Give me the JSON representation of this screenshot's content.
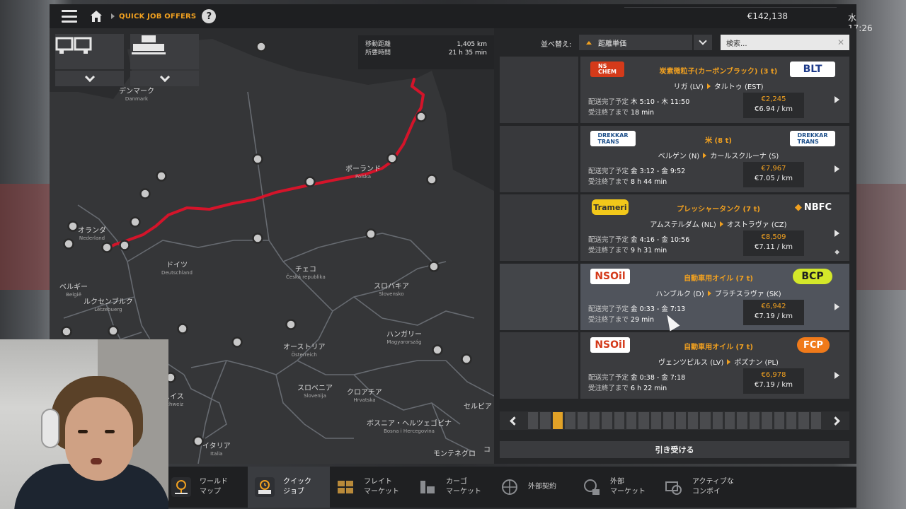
{
  "topbar": {
    "breadcrumb": "QUICK JOB OFFERS",
    "money": "€142,138",
    "clock": "水 17:26"
  },
  "route_info": {
    "distance_label": "移動距離",
    "distance": "1,405 km",
    "time_label": "所要時間",
    "time": "21 h 35 min"
  },
  "map": {
    "labels": [
      {
        "id": "denmark",
        "name": "デンマーク",
        "sub": "Danmark"
      },
      {
        "id": "poland",
        "name": "ポーランド",
        "sub": "Polska"
      },
      {
        "id": "netherlands",
        "name": "オランダ",
        "sub": "Nederland"
      },
      {
        "id": "germany",
        "name": "ドイツ",
        "sub": "Deutschland"
      },
      {
        "id": "czech",
        "name": "チェコ",
        "sub": "Česká republika"
      },
      {
        "id": "belgium",
        "name": "ベルギー",
        "sub": "België"
      },
      {
        "id": "luxembourg",
        "name": "ルクセンブルク",
        "sub": "Lëtzebuerg"
      },
      {
        "id": "slovakia",
        "name": "スロバキア",
        "sub": "Slovensko"
      },
      {
        "id": "hungary",
        "name": "ハンガリー",
        "sub": "Magyarország"
      },
      {
        "id": "austria",
        "name": "オーストリア",
        "sub": "Österreich"
      },
      {
        "id": "switzerland",
        "name": "スイス",
        "sub": "Schweiz"
      },
      {
        "id": "slovenia",
        "name": "スロベニア",
        "sub": "Slovenija"
      },
      {
        "id": "croatia",
        "name": "クロアチア",
        "sub": "Hrvatska"
      },
      {
        "id": "serbia",
        "name": "セルビア",
        "sub": ""
      },
      {
        "id": "bosnia",
        "name": "ボスニア・ヘルツェゴビナ",
        "sub": "Bosna i Hercegovina"
      },
      {
        "id": "italy",
        "name": "イタリア",
        "sub": "Italia"
      },
      {
        "id": "montenegro",
        "name": "モンテネグロ",
        "sub": ""
      },
      {
        "id": "kosovo",
        "name": "コ",
        "sub": ""
      }
    ]
  },
  "sort": {
    "label": "並べ替え:",
    "selected": "距離単価",
    "search_placeholder": "検索..."
  },
  "jobs": [
    {
      "logo_left": "NS CHEMICALS",
      "logo_right": "BLT",
      "cargo": "炭素微粒子(カーボンブラック) (3 t)",
      "origin": "リガ (LV)",
      "destination": "タルトゥ (EST)",
      "delivery_label": "配送完了予定",
      "delivery": "木 5:10 - 木 11:50",
      "expiry_label": "受注終了まで",
      "expiry": "18 min",
      "price": "€2,245",
      "rate": "€6.94 / km"
    },
    {
      "logo_left": "DREKKAR TRANS",
      "logo_right": "DREKKAR TRANS",
      "cargo": "米 (8 t)",
      "origin": "ベルゲン (N)",
      "destination": "カールスクルーナ (S)",
      "delivery_label": "配送完了予定",
      "delivery": "金 3:12 - 金 9:52",
      "expiry_label": "受注終了まで",
      "expiry": "8 h 44 min",
      "price": "€7,967",
      "rate": "€7.05 / km"
    },
    {
      "logo_left": "Trameri",
      "logo_right": "NBFC",
      "cargo": "プレッシャータンク (7 t)",
      "origin": "アムステルダム (NL)",
      "destination": "オストラヴァ (CZ)",
      "delivery_label": "配送完了予定",
      "delivery": "金 4:16 - 金 10:56",
      "expiry_label": "受注終了まで",
      "expiry": "9 h 31 min",
      "price": "€8,509",
      "rate": "€7.11 / km"
    },
    {
      "logo_left": "NSOil",
      "logo_right": "BCP",
      "cargo": "自動車用オイル (7 t)",
      "origin": "ハンブルク (D)",
      "destination": "ブラチスラヴァ (SK)",
      "delivery_label": "配送完了予定",
      "delivery": "金 0:33 - 金 7:13",
      "expiry_label": "受注終了まで",
      "expiry": "29 min",
      "price": "€6,942",
      "rate": "€7.19 / km"
    },
    {
      "logo_left": "NSOil",
      "logo_right": "FCP",
      "cargo": "自動車用オイル (7 t)",
      "origin": "ヴェンツピルス (LV)",
      "destination": "ポズナン (PL)",
      "delivery_label": "配送完了予定",
      "delivery": "金 0:38 - 金 7:18",
      "expiry_label": "受注終了まで",
      "expiry": "6 h 22 min",
      "price": "€6,978",
      "rate": "€7.19 / km"
    }
  ],
  "accept_label": "引き受ける",
  "bottom_nav": [
    {
      "label": "ワールド\nマップ",
      "icon": "world-map-icon"
    },
    {
      "label": "クイック\nジョブ",
      "icon": "quick-job-icon"
    },
    {
      "label": "フレイト\nマーケット",
      "icon": "freight-market-icon"
    },
    {
      "label": "カーゴ\nマーケット",
      "icon": "cargo-market-icon"
    },
    {
      "label": "外部契約",
      "icon": "external-contract-icon"
    },
    {
      "label": "外部\nマーケット",
      "icon": "external-market-icon"
    },
    {
      "label": "アクティブな\nコンボイ",
      "icon": "active-convoy-icon"
    }
  ],
  "colors": {
    "accent": "#f0a020",
    "route": "#d4142a"
  }
}
